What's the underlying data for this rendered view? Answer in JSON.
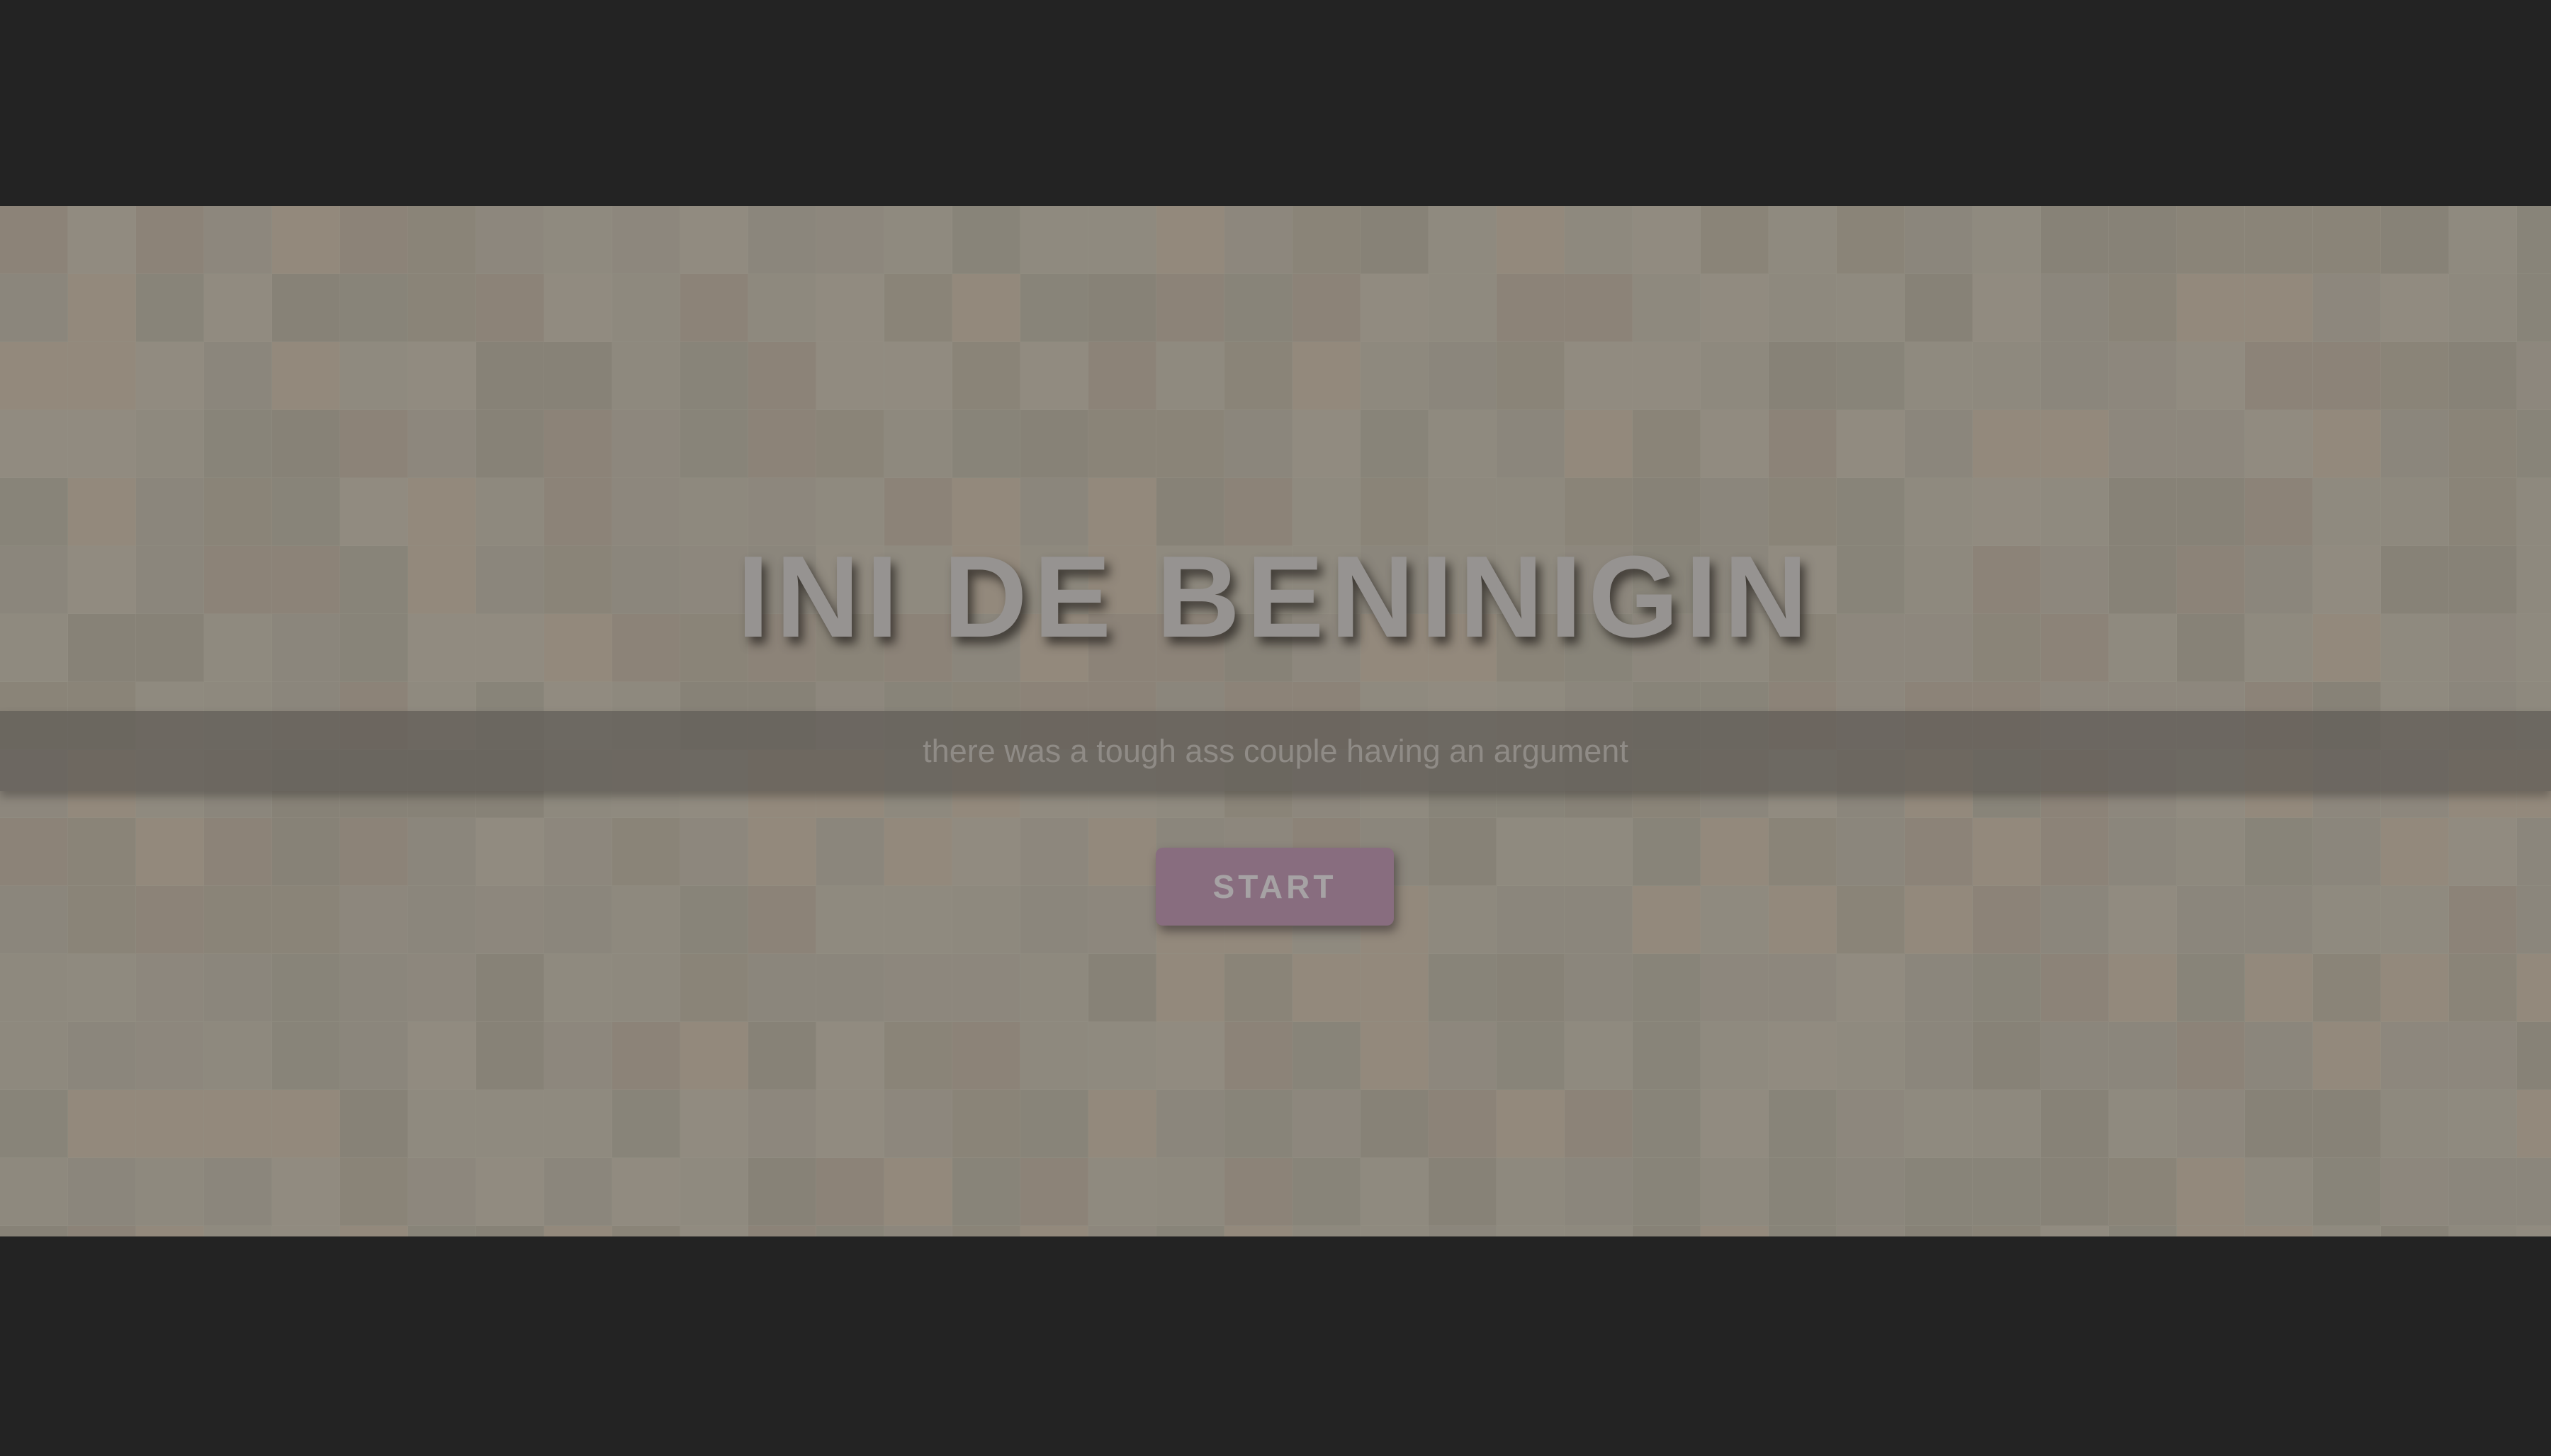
{
  "title_screen": {
    "title": "INI DE BENINIGIN",
    "subtitle": "there was a tough ass couple having an argument",
    "start_label": "START"
  },
  "colors": {
    "letterbox": "#232323",
    "tile_palette": [
      "#8f8a7f",
      "#8b867c",
      "#918b80",
      "#888479",
      "#8e897e",
      "#8c8378",
      "#93897c",
      "#878277",
      "#8a8478",
      "#8d877d"
    ],
    "subtitle_band": "#5f5c56",
    "start_button": "#886d7f",
    "title_text": "#969391"
  }
}
